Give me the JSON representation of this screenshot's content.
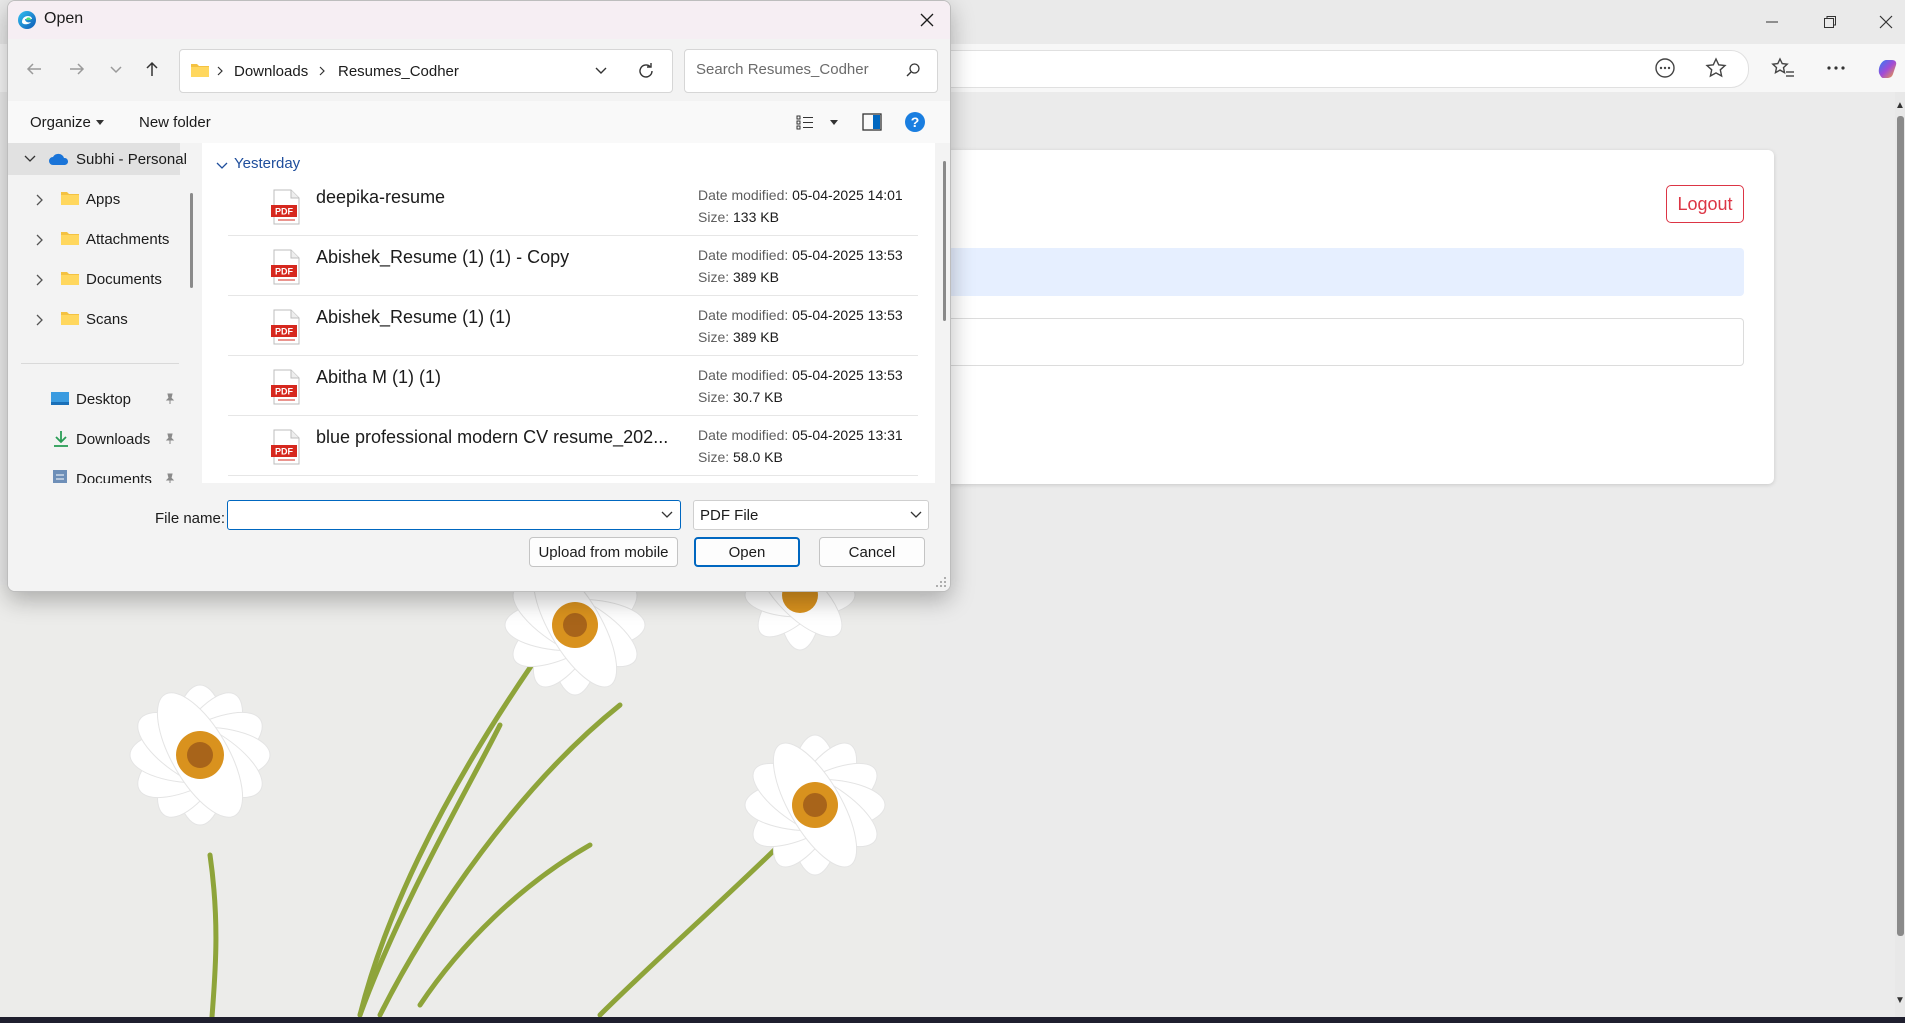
{
  "browser": {
    "logout_label": "Logout"
  },
  "dialog": {
    "title": "Open",
    "breadcrumb": [
      "Downloads",
      "Resumes_Codher"
    ],
    "search_placeholder": "Search Resumes_Codher",
    "organize_label": "Organize",
    "new_folder_label": "New folder",
    "nav_items": [
      {
        "label": "Subhi - Personal",
        "icon": "onedrive-cloud-icon"
      },
      {
        "label": "Apps",
        "icon": "folder-icon"
      },
      {
        "label": "Attachments",
        "icon": "folder-icon"
      },
      {
        "label": "Documents",
        "icon": "folder-icon"
      },
      {
        "label": "Scans",
        "icon": "folder-icon"
      },
      {
        "label": "Desktop",
        "icon": "desktop-icon"
      },
      {
        "label": "Downloads",
        "icon": "download-icon"
      },
      {
        "label": "Documents",
        "icon": "documents-icon"
      }
    ],
    "group_header": "Yesterday",
    "date_modified_key": "Date modified:",
    "size_key": "Size:",
    "files": [
      {
        "name": "deepika-resume",
        "date_modified": "05-04-2025 14:01",
        "size": "133 KB",
        "icon_label": "PDF"
      },
      {
        "name": "Abishek_Resume (1) (1) - Copy",
        "date_modified": "05-04-2025 13:53",
        "size": "389 KB",
        "icon_label": "PDF"
      },
      {
        "name": "Abishek_Resume (1) (1)",
        "date_modified": "05-04-2025 13:53",
        "size": "389 KB",
        "icon_label": "PDF"
      },
      {
        "name": "Abitha M (1) (1)",
        "date_modified": "05-04-2025 13:53",
        "size": "30.7 KB",
        "icon_label": "PDF"
      },
      {
        "name": "blue professional modern CV resume_202...",
        "date_modified": "05-04-2025 13:31",
        "size": "58.0 KB",
        "icon_label": "PDF"
      }
    ],
    "file_name_label": "File name:",
    "file_name_value": "",
    "file_type": "PDF File",
    "upload_label": "Upload from mobile",
    "open_label": "Open",
    "cancel_label": "Cancel"
  },
  "colors": {
    "accent": "#0067c0",
    "logout": "#dc3545",
    "pdf_red": "#d6281e"
  }
}
